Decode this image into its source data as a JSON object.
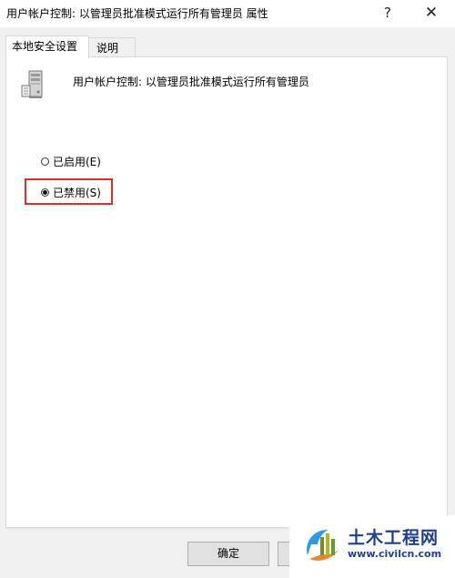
{
  "window": {
    "title": "用户帐户控制: 以管理员批准模式运行所有管理员 属性",
    "help_label": "?",
    "close_label": "✕"
  },
  "tabs": [
    {
      "label": "本地安全设置",
      "active": true
    },
    {
      "label": "说明",
      "active": false
    }
  ],
  "policy": {
    "icon": "server-policy-icon",
    "name": "用户帐户控制: 以管理员批准模式运行所有管理员"
  },
  "options": {
    "enabled": {
      "label": "已启用(E)",
      "checked": false
    },
    "disabled": {
      "label": "已禁用(S)",
      "checked": true
    }
  },
  "annotation": {
    "highlight_color": "#e32b2b"
  },
  "buttons": {
    "ok_label": "确定"
  },
  "watermark": {
    "title": "土木工程网",
    "url": "www.civilcn.com"
  }
}
